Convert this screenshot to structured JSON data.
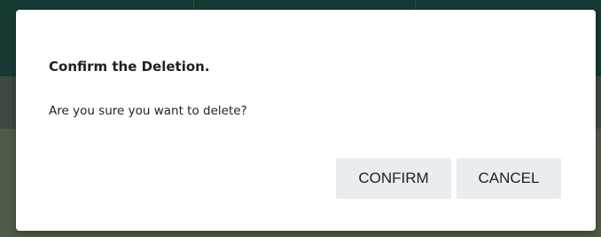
{
  "dialog": {
    "title": "Confirm the Deletion.",
    "message": "Are you sure you want to delete?",
    "confirm_label": "CONFIRM",
    "cancel_label": "CANCEL"
  },
  "colors": {
    "backdrop_top": "#163a33",
    "backdrop_bottom": "#4f5a48",
    "dialog_bg": "#ffffff",
    "button_bg": "#eaedef",
    "text": "#222222"
  }
}
